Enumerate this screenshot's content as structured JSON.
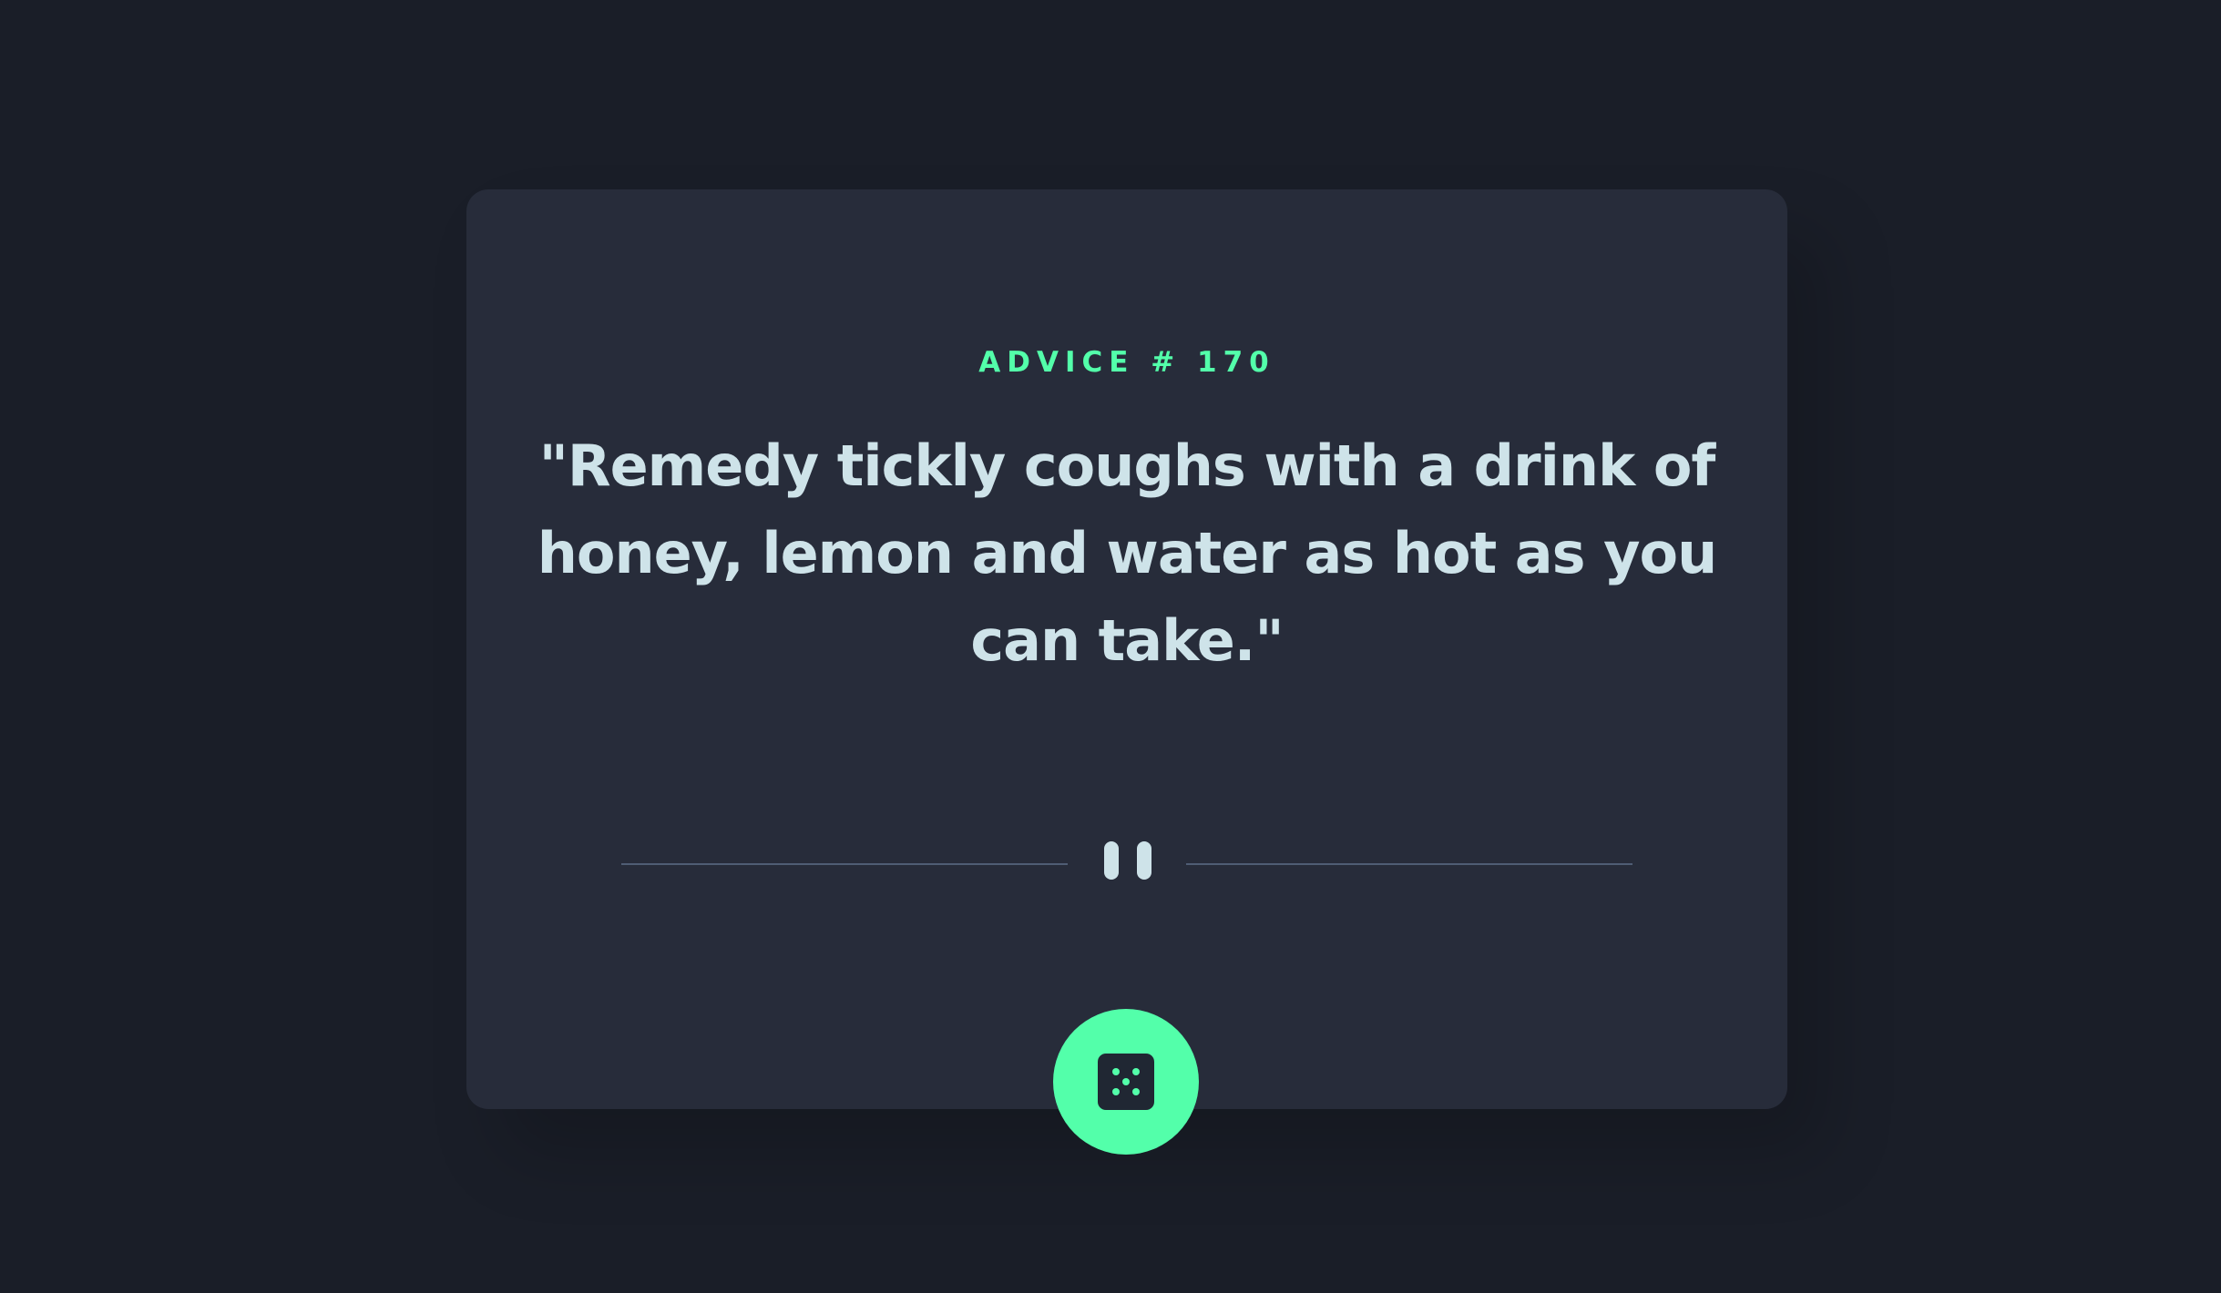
{
  "advice": {
    "label": "ADVICE # 170",
    "quote": "\"Remedy tickly coughs with a drink of honey, lemon and water as hot as you can take.\""
  },
  "icons": {
    "divider": "pause-icon",
    "button": "dice-icon"
  },
  "colors": {
    "background": "#1a1e28",
    "card": "#272c3a",
    "accent": "#53ffaa",
    "text": "#cee3e9",
    "divider": "#4f5d74",
    "dice": "#202733"
  }
}
